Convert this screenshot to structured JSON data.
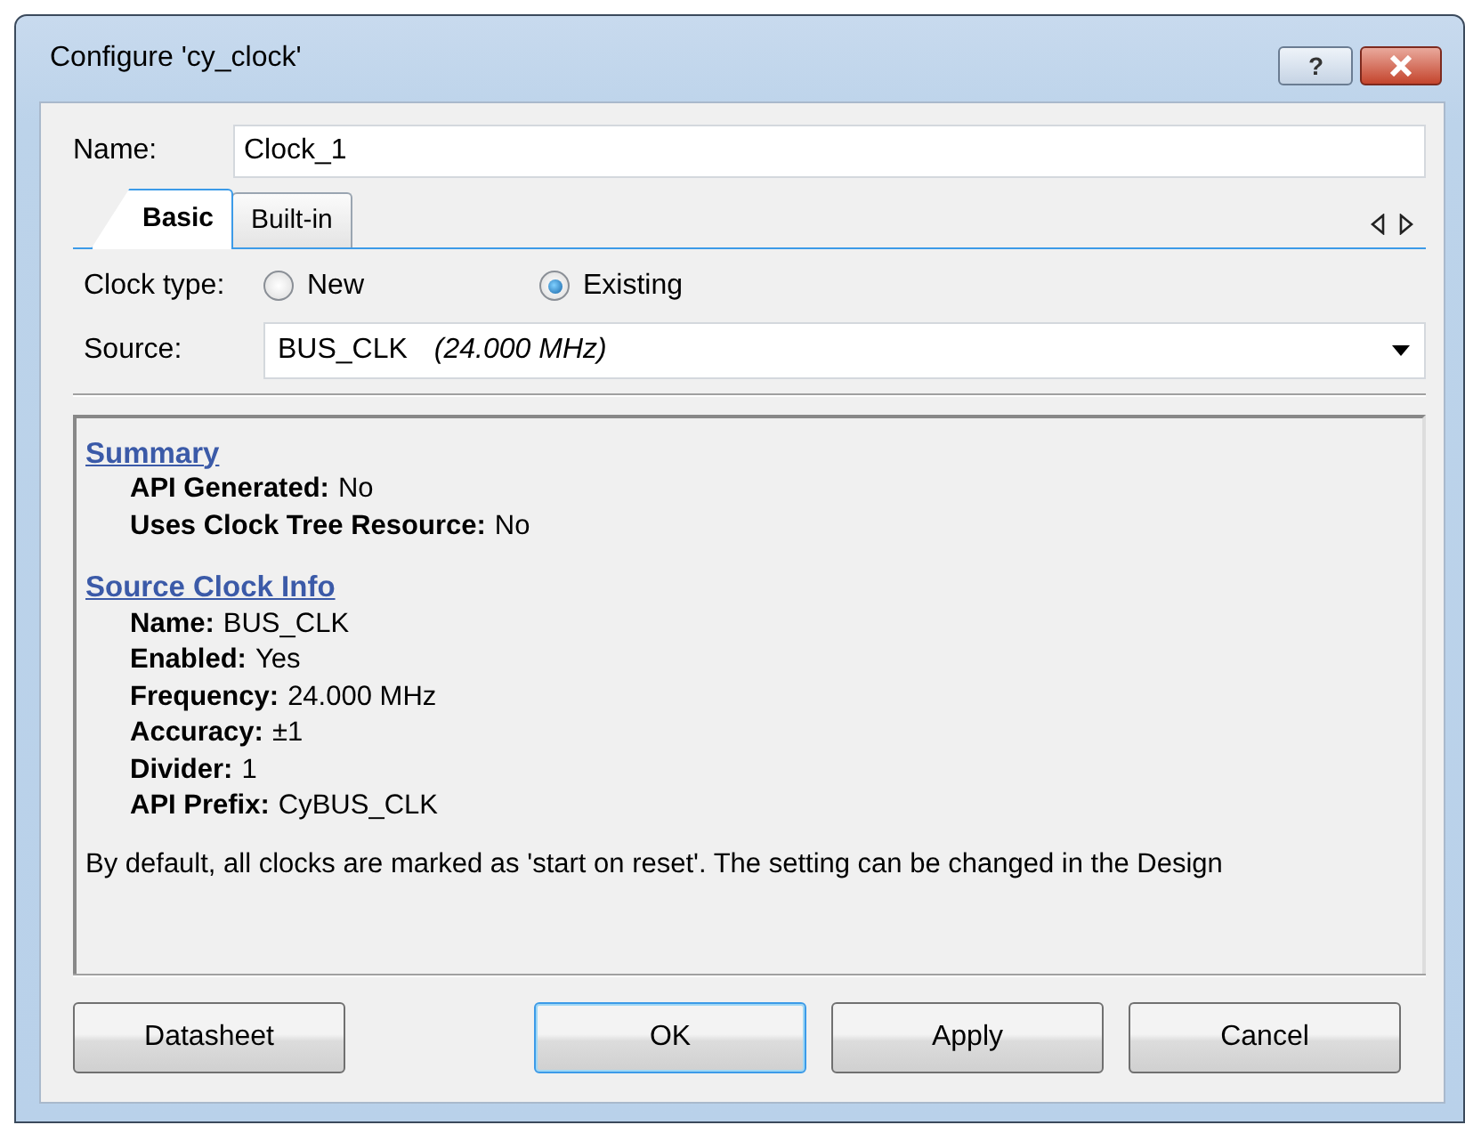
{
  "window": {
    "title": "Configure 'cy_clock'",
    "help_button": "?"
  },
  "name_field": {
    "label": "Name:",
    "value": "Clock_1"
  },
  "tabs": [
    {
      "label": "Basic",
      "selected": true
    },
    {
      "label": "Built-in",
      "selected": false
    }
  ],
  "clock_type": {
    "label": "Clock type:",
    "options": [
      {
        "label": "New",
        "selected": false
      },
      {
        "label": "Existing",
        "selected": true
      }
    ]
  },
  "source": {
    "label": "Source:",
    "value": "BUS_CLK",
    "detail": "(24.000 MHz)"
  },
  "info": {
    "sections": [
      {
        "heading": "Summary",
        "rows": [
          {
            "key": "API Generated:",
            "value": "No"
          },
          {
            "key": "Uses Clock Tree Resource:",
            "value": "No"
          }
        ]
      },
      {
        "heading": "Source Clock Info",
        "rows": [
          {
            "key": "Name:",
            "value": "BUS_CLK"
          },
          {
            "key": "Enabled:",
            "value": "Yes"
          },
          {
            "key": "Frequency:",
            "value": "24.000 MHz"
          },
          {
            "key": "Accuracy:",
            "value": "±1"
          },
          {
            "key": "Divider:",
            "value": "1"
          },
          {
            "key": "API Prefix:",
            "value": "CyBUS_CLK"
          }
        ]
      }
    ],
    "note": "By default, all clocks are marked as 'start on reset'. The setting can be changed in the Design"
  },
  "buttons": [
    {
      "label": "Datasheet",
      "default": false
    },
    {
      "label": "OK",
      "default": true
    },
    {
      "label": "Apply",
      "default": false
    },
    {
      "label": "Cancel",
      "default": false
    }
  ]
}
